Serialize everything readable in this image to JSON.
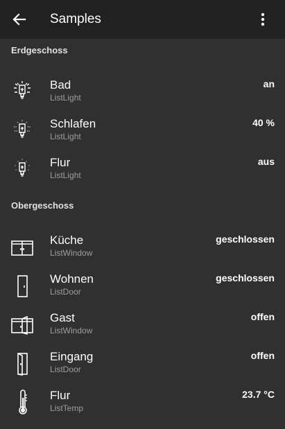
{
  "appbar": {
    "title": "Samples",
    "back_icon": "arrow-back-icon",
    "menu_icon": "more-vert-icon"
  },
  "sections": [
    {
      "header": "Erdgeschoss"
    },
    {
      "header": "Obergeschoss"
    }
  ],
  "items": [
    {
      "name": "Bad",
      "type": "ListLight",
      "value": "an",
      "icon": "light-bulb-on-icon"
    },
    {
      "name": "Schlafen",
      "type": "ListLight",
      "value": "40 %",
      "icon": "light-bulb-dim-icon"
    },
    {
      "name": "Flur",
      "type": "ListLight",
      "value": "aus",
      "icon": "light-bulb-off-icon"
    },
    {
      "name": "Küche",
      "type": "ListWindow",
      "value": "geschlossen",
      "icon": "window-closed-icon"
    },
    {
      "name": "Wohnen",
      "type": "ListDoor",
      "value": "geschlossen",
      "icon": "door-closed-icon"
    },
    {
      "name": "Gast",
      "type": "ListWindow",
      "value": "offen",
      "icon": "window-open-icon"
    },
    {
      "name": "Eingang",
      "type": "ListDoor",
      "value": "offen",
      "icon": "door-open-icon"
    },
    {
      "name": "Flur",
      "type": "ListTemp",
      "value": "23.7 °C",
      "icon": "thermometer-icon"
    }
  ],
  "colors": {
    "background": "#303030",
    "appbar": "#212121",
    "text_primary": "#ffffff",
    "text_secondary": "#9e9e9e"
  }
}
